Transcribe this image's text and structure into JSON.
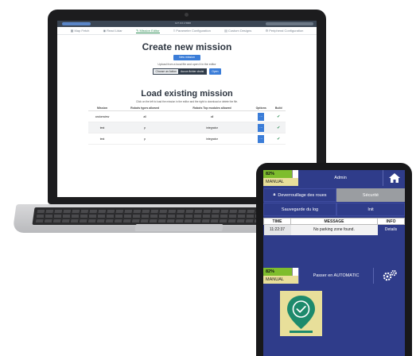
{
  "browser": {
    "center_text": "127.0.0.1:5000"
  },
  "nav": {
    "items": [
      {
        "label": "Map Fetch",
        "icon": "map-icon"
      },
      {
        "label": "Read Lidar",
        "icon": "radar-icon"
      },
      {
        "label": "Mission Editor",
        "icon": "edit-icon",
        "active": true
      },
      {
        "label": "Parameter Configuration",
        "icon": "sliders-icon"
      },
      {
        "label": "Custom Designs",
        "icon": "design-icon"
      },
      {
        "label": "Peripheral Configuration",
        "icon": "cog-icon"
      }
    ]
  },
  "create": {
    "title": "Create new mission",
    "new_button": "New mission",
    "upload_note": "Upload from a local file and open it in the editor",
    "choose_label": "Choose an Action",
    "file_placeholder": "Aucun fichier choisi",
    "open_button": "Open"
  },
  "load": {
    "title": "Load existing mission",
    "note": "Click on the left to load the mission in the editor and the right to download or delete the file.",
    "columns": [
      "Mission",
      "Robots types allowed",
      "Robots Top modules allowed",
      "Options",
      "Build"
    ],
    "rows": [
      {
        "mission": "andonwiew",
        "robots": "all",
        "modules": "all"
      },
      {
        "mission": "test",
        "robots": "p",
        "modules": "integrator"
      },
      {
        "mission": "test",
        "robots": "p",
        "modules": "integrator"
      }
    ]
  },
  "tablet": {
    "battery_percent": "82%",
    "battery_level": 0.82,
    "mode": "MANUAL",
    "user": "Admin",
    "buttons": {
      "unlock": "Deverrouillage des roues",
      "safety": "Sécurité",
      "save_log": "Sauvegarde du log",
      "init": "Init",
      "auto": "Passer en AUTOMATIC"
    },
    "log": {
      "headers": [
        "TIME",
        "MESSAGE",
        "INFO"
      ],
      "rows": [
        {
          "time": "11:22:37",
          "message": "No parking zone found.",
          "info": "Details"
        }
      ]
    },
    "bottom_battery_percent": "82%",
    "bottom_mode": "MANUAL"
  },
  "colors": {
    "tablet_blue": "#2f3c8a",
    "battery_green": "#7ebd2d",
    "mode_yellow": "#e8df9a",
    "pin_green": "#1d8a6c",
    "link_blue": "#3b7dd8"
  }
}
